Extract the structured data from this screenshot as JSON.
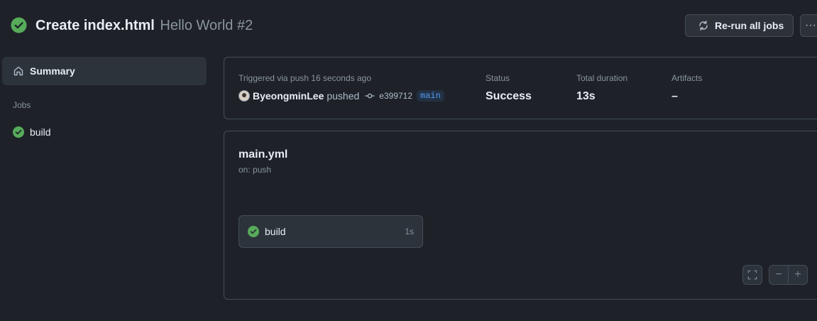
{
  "header": {
    "title": "Create index.html",
    "run_name": "Hello World #2",
    "rerun_label": "Re-run all jobs",
    "more_label": "···"
  },
  "sidebar": {
    "summary_label": "Summary",
    "jobs_heading": "Jobs",
    "jobs": [
      {
        "label": "build",
        "status": "success"
      }
    ]
  },
  "summary": {
    "trigger_text": "Triggered via push 16 seconds ago",
    "actor": "ByeongminLee",
    "action": "pushed",
    "commit_sha": "e399712",
    "branch": "main",
    "status_label": "Status",
    "status_value": "Success",
    "duration_label": "Total duration",
    "duration_value": "13s",
    "artifacts_label": "Artifacts",
    "artifacts_value": "–"
  },
  "workflow": {
    "file": "main.yml",
    "trigger": "on: push",
    "job": {
      "label": "build",
      "duration": "1s",
      "status": "success"
    },
    "controls": {
      "minus": "−",
      "plus": "+"
    }
  },
  "colors": {
    "success": "#57ab5a",
    "background": "#1e2228",
    "branch": "#539bf5"
  }
}
